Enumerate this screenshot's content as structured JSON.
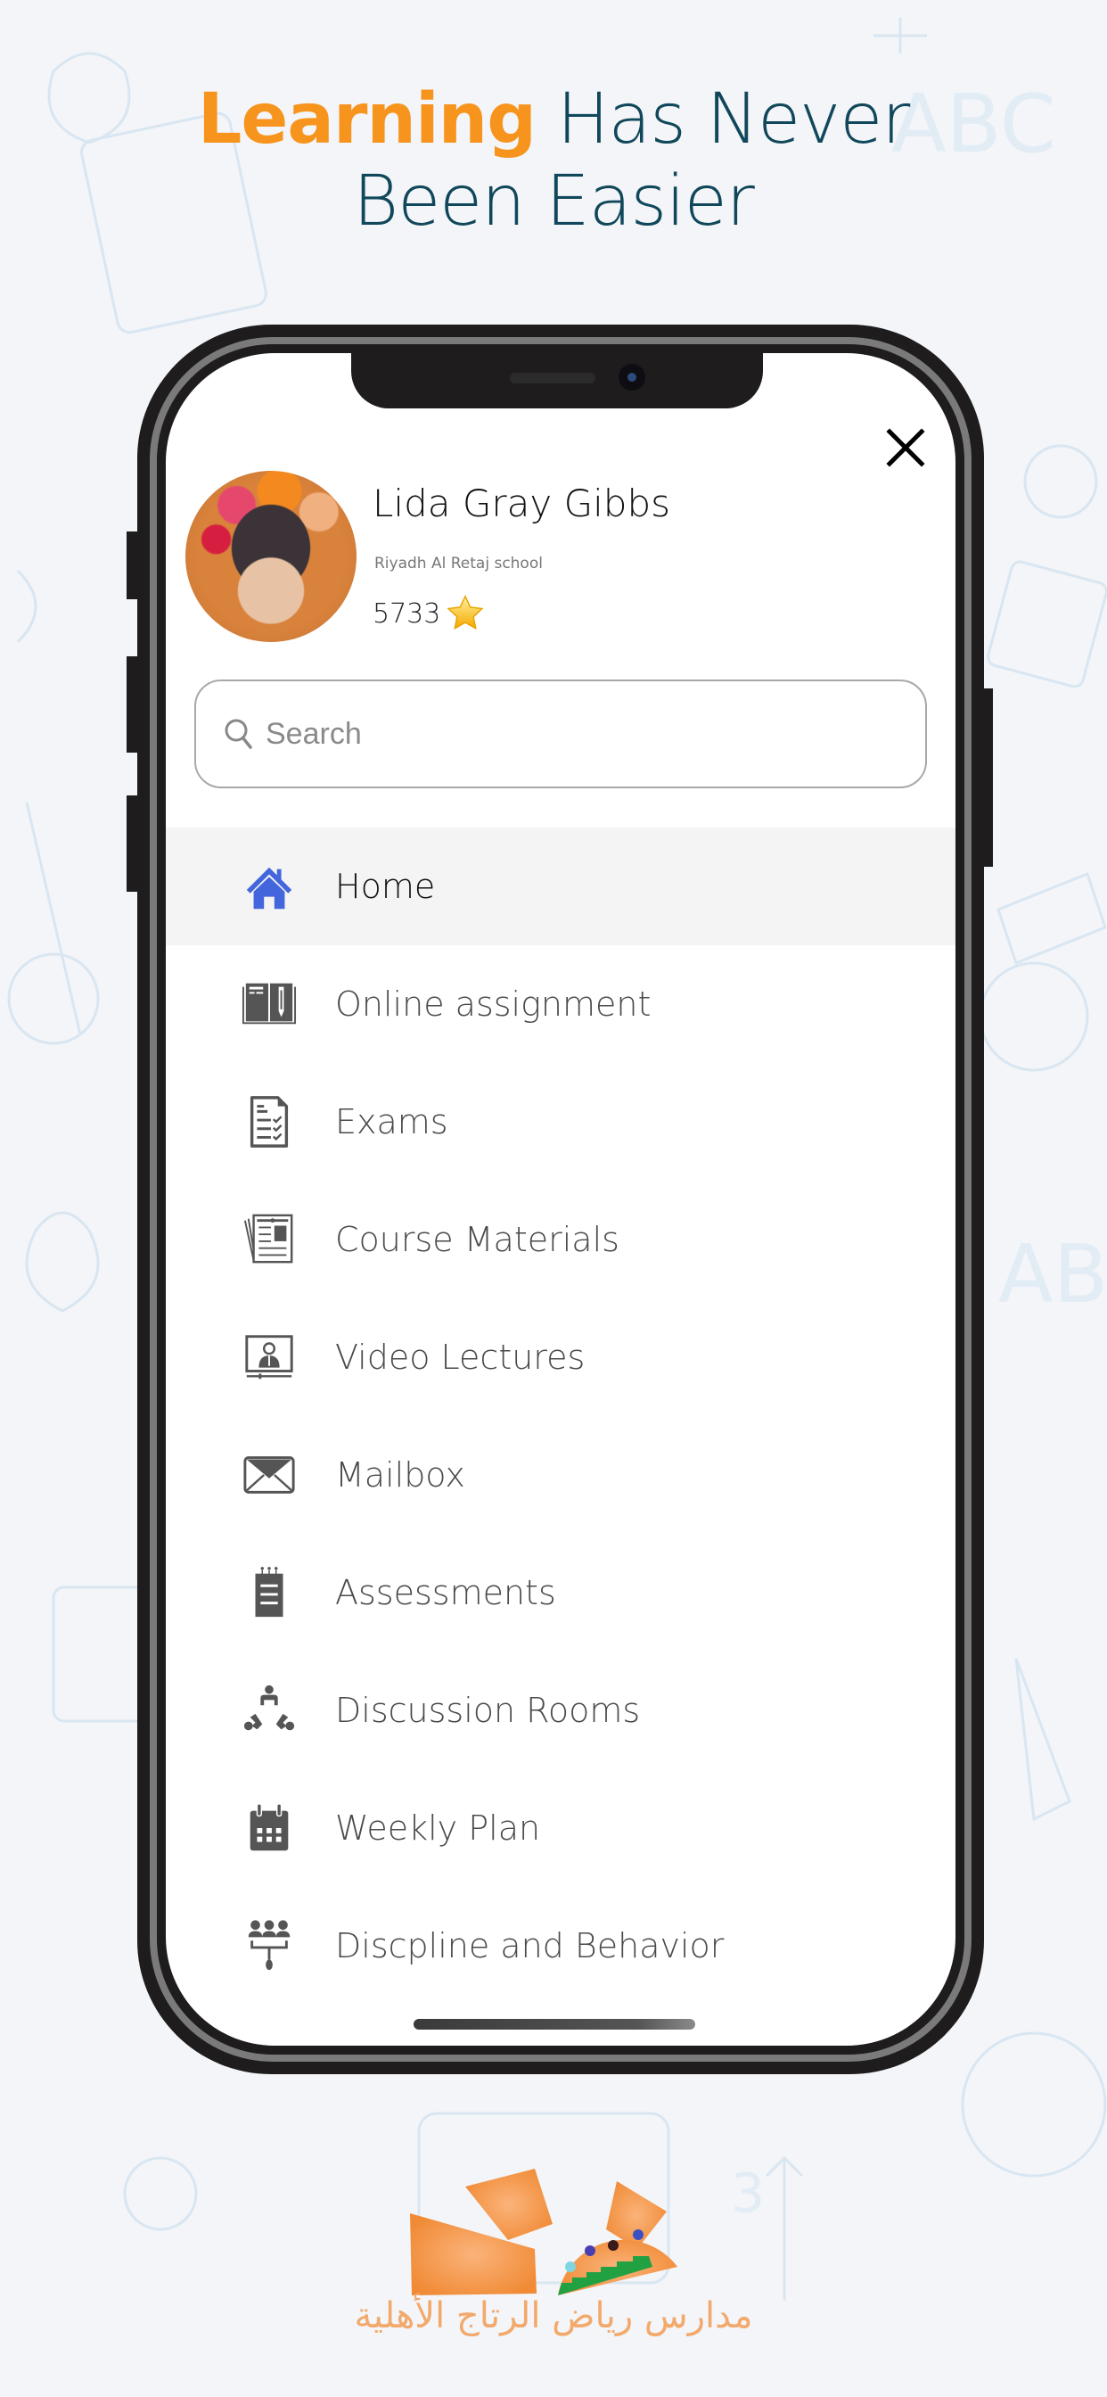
{
  "headline": {
    "accent": "Learning",
    "line1_rest": " Has Never",
    "line2": "Been Easier"
  },
  "colors": {
    "accent_orange": "#f7941d",
    "headline_teal": "#10475a",
    "home_icon_blue": "#4466dd",
    "menu_icon_gray": "#555555",
    "active_row_bg": "#f4f4f4"
  },
  "drawer": {
    "close_icon": "close-icon",
    "profile": {
      "name": "Lida Gray Gibbs",
      "school": "Riyadh Al Retaj school",
      "points": "5733",
      "points_icon": "star-icon"
    },
    "search": {
      "placeholder": "Search",
      "value": ""
    },
    "menu": [
      {
        "label": "Home",
        "icon": "home-icon",
        "active": true
      },
      {
        "label": "Online assignment",
        "icon": "book-pencil-icon",
        "active": false
      },
      {
        "label": "Exams",
        "icon": "checklist-document-icon",
        "active": false
      },
      {
        "label": "Course Materials",
        "icon": "newspaper-icon",
        "active": false
      },
      {
        "label": "Video Lectures",
        "icon": "video-presenter-icon",
        "active": false
      },
      {
        "label": "Mailbox",
        "icon": "envelope-icon",
        "active": false
      },
      {
        "label": "Assessments",
        "icon": "notepad-icon",
        "active": false
      },
      {
        "label": "Discussion Rooms",
        "icon": "discussion-group-icon",
        "active": false
      },
      {
        "label": "Weekly Plan",
        "icon": "calendar-icon",
        "active": false
      },
      {
        "label": "Discpline and Behavior",
        "icon": "hierarchy-people-icon",
        "active": false
      }
    ]
  },
  "footer": {
    "logo_text": "مدارس رياض الرتاج الأهلية"
  }
}
